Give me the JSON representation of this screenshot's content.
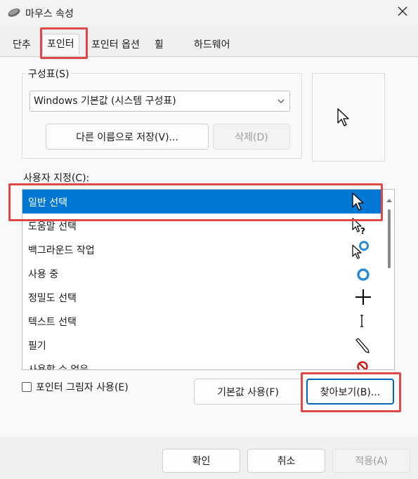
{
  "window": {
    "title": "마우스 속성",
    "title_icon": "mouse-icon",
    "close_icon": "close-icon"
  },
  "tabs": [
    {
      "label": "단추"
    },
    {
      "label": "포인터",
      "active": true
    },
    {
      "label": "포인터 옵션"
    },
    {
      "label": "휠"
    },
    {
      "label": "하드웨어"
    }
  ],
  "scheme": {
    "group_label": "구성표(S)",
    "selected_value": "Windows 기본값 (시스템 구성표)",
    "save_as_label": "다른 이름으로 저장(V)...",
    "delete_label": "삭제(D)"
  },
  "customize": {
    "label": "사용자 지정(C):",
    "items": [
      {
        "label": "일반 선택",
        "icon": "arrow-cursor-icon",
        "selected": true
      },
      {
        "label": "도움말 선택",
        "icon": "help-cursor-icon"
      },
      {
        "label": "백그라운드 작업",
        "icon": "working-in-background-cursor-icon"
      },
      {
        "label": "사용 중",
        "icon": "busy-cursor-icon"
      },
      {
        "label": "정밀도 선택",
        "icon": "precision-cursor-icon"
      },
      {
        "label": "텍스트 선택",
        "icon": "text-cursor-icon"
      },
      {
        "label": "필기",
        "icon": "handwriting-cursor-icon"
      },
      {
        "label": "사용할 수 없음",
        "icon": "unavailable-cursor-icon"
      }
    ]
  },
  "options": {
    "shadow_label": "포인터 그림자 사용(E)",
    "shadow_checked": false,
    "use_default_label": "기본값 사용(F)",
    "browse_label": "찾아보기(B)..."
  },
  "footer": {
    "ok_label": "확인",
    "cancel_label": "취소",
    "apply_label": "적용(A)"
  },
  "colors": {
    "selection": "#0078d4",
    "highlight_annotation": "#e04848"
  }
}
